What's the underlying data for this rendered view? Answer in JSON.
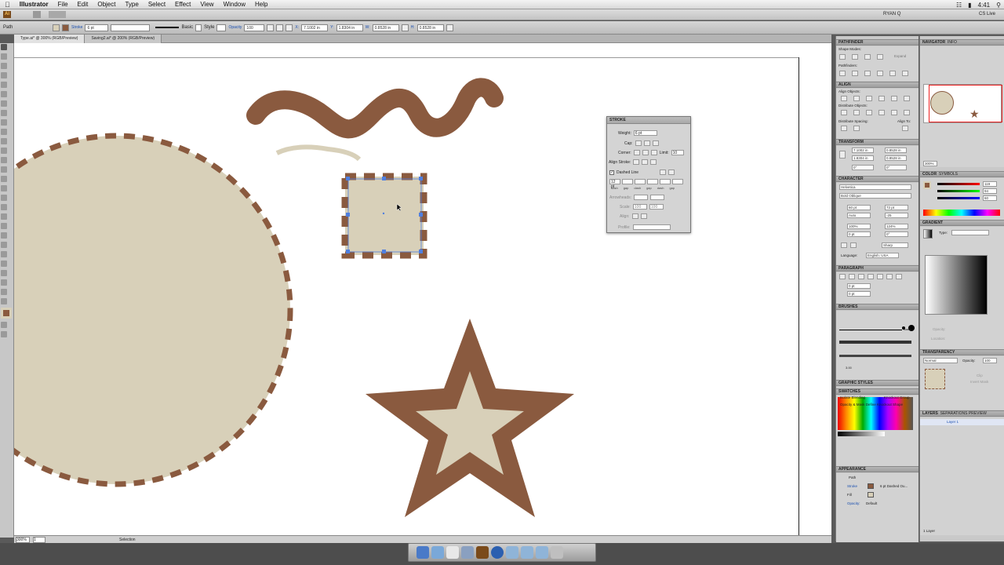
{
  "menubar": {
    "app_name": "Illustrator",
    "items": [
      "File",
      "Edit",
      "Object",
      "Type",
      "Select",
      "Effect",
      "View",
      "Window",
      "Help"
    ],
    "user": "RYAN Q",
    "time": "4:41",
    "cs_live": "CS Live"
  },
  "control_bar": {
    "selection_type": "Path",
    "stroke_label": "Stroke",
    "stroke_weight": "6 pt",
    "brush_label": "Basic",
    "style_label": "Style",
    "opacity_label": "Opacity",
    "opacity_value": "100",
    "x_value": "7.1002 in",
    "y_value": "1.8304 in",
    "w_value": "0.8528 in",
    "h_value": "0.8528 in"
  },
  "tabs": [
    {
      "label": "Type.ai* @ 300% (RGB/Preview)",
      "active": true
    },
    {
      "label": "Saving2.ai* @ 200% (RGB/Preview)",
      "active": false
    }
  ],
  "status_bar": {
    "zoom": "300%",
    "page": "1",
    "tool": "Selection"
  },
  "stroke_panel": {
    "title": "STROKE",
    "weight_label": "Weight:",
    "weight_value": "6 pt",
    "cap_label": "Cap:",
    "corner_label": "Corner:",
    "limit_label": "Limit:",
    "limit_value": "10",
    "align_label": "Align Stroke:",
    "dashed_label": "Dashed Line",
    "dash_first": "12 pt",
    "dash_cols": [
      "dash",
      "gap",
      "dash",
      "gap",
      "dash",
      "gap"
    ],
    "arrowheads_label": "Arrowheads:",
    "scale_label": "Scale:",
    "scale_a": "100",
    "scale_b": "100",
    "align_label2": "Align:",
    "profile_label": "Profile:"
  },
  "panels": {
    "pathfinder": "PATHFINDER",
    "shape_modes": "Shape Modes:",
    "expand": "Expand",
    "pathfinders": "Pathfinders:",
    "align": "ALIGN",
    "align_objects": "Align Objects:",
    "distribute_objects": "Distribute Objects:",
    "distribute_spacing": "Distribute Spacing:",
    "align_to": "Align To:",
    "transform": "TRANSFORM",
    "tx": "7.1002 in",
    "ty": "1.8304 in",
    "tw": "0.8528 in",
    "th": "0.8528 in",
    "angle": "0°",
    "shear": "0°",
    "character": "CHARACTER",
    "font": "Helvetica",
    "font_style": "Bold Oblique",
    "size": "60 pt",
    "leading": "72 pt",
    "kerning": "Auto",
    "tracking": "-25",
    "vscale": "100%",
    "hscale": "124%",
    "baseline": "0 pt",
    "rotation": "0°",
    "aa": "Sharp",
    "language_label": "Language:",
    "language": "English: USA",
    "paragraph": "PARAGRAPH",
    "indent_left": "0 pt",
    "indent_right": "0 pt",
    "brushes": "BRUSHES",
    "brush_basic": "Basic",
    "brush_size": "3.00",
    "graphic_styles": "GRAPHIC STYLES",
    "swatches": "SWATCHES",
    "appearance": "APPEARANCE",
    "app_path": "Path",
    "app_stroke": "Stroke",
    "app_stroke_val": "6 pt Dashed Ou...",
    "app_fill": "Fill",
    "app_opacity": "Opacity:",
    "app_opacity_val": "Default",
    "navigator": "NAVIGATOR",
    "info": "INFO",
    "nav_zoom": "300%",
    "color": "COLOR",
    "symbols": "SYMBOLS",
    "color_r": "119",
    "color_g": "94",
    "color_b": "60",
    "gradient": "GRADIENT",
    "gradient_type": "Type:",
    "gradient_opacity": "Opacity:",
    "gradient_location": "Location:",
    "transparency": "TRANSPARENCY",
    "blend_mode": "Normal",
    "opacity_label": "Opacity:",
    "opacity_value": "100",
    "clip": "Clip",
    "invert_mask": "Invert Mask",
    "isolate_blending": "Isolate Blending",
    "knockout_group": "Knockout Group",
    "opacity_mask": "Opacity & Mask Define Knockout Shape",
    "layers": "LAYERS",
    "separations": "SEPARATIONS PREVIEW",
    "layer1": "Layer 1",
    "layer_count": "1 Layer"
  },
  "art_colors": {
    "fill": "#d8d0b9",
    "stroke": "#8a5a3f"
  }
}
